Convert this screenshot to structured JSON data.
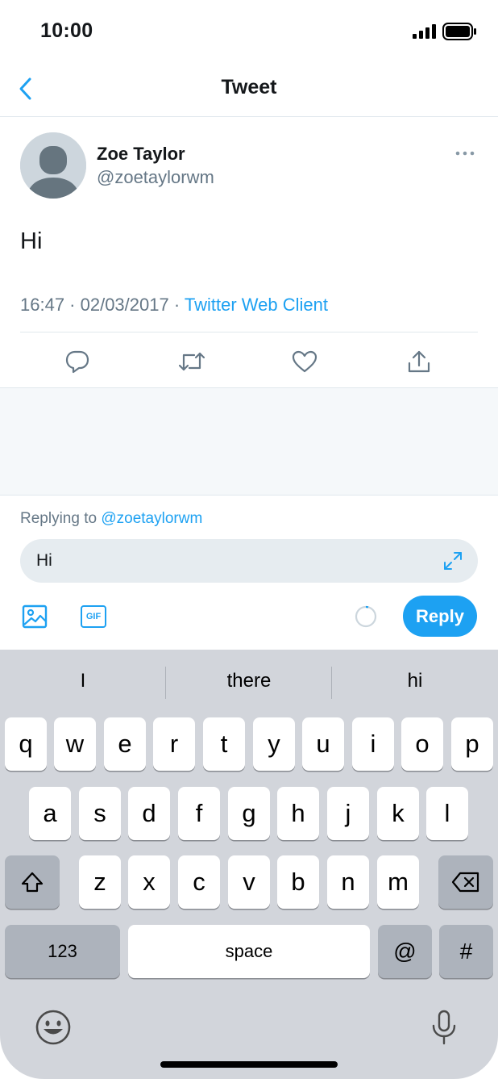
{
  "status_bar": {
    "time": "10:00"
  },
  "nav": {
    "title": "Tweet",
    "back_icon": "chevron-left-icon"
  },
  "tweet": {
    "author_name": "Zoe Taylor",
    "author_handle": "@zoetaylorwm",
    "text": "Hi",
    "timestamp": "16:47 · 02/03/2017 · ",
    "source": "Twitter Web Client",
    "actions": [
      "reply-icon",
      "retweet-icon",
      "like-icon",
      "share-icon"
    ]
  },
  "composer": {
    "replying_prefix": "Replying to ",
    "replying_handle": "@zoetaylorwm",
    "input_value": "Hi",
    "gif_label": "GIF",
    "reply_label": "Reply"
  },
  "keyboard": {
    "suggestions": [
      "I",
      "there",
      "hi"
    ],
    "row1": [
      "q",
      "w",
      "e",
      "r",
      "t",
      "y",
      "u",
      "i",
      "o",
      "p"
    ],
    "row2": [
      "a",
      "s",
      "d",
      "f",
      "g",
      "h",
      "j",
      "k",
      "l"
    ],
    "row3": [
      "z",
      "x",
      "c",
      "v",
      "b",
      "n",
      "m"
    ],
    "numbers_label": "123",
    "space_label": "space",
    "at_label": "@",
    "hash_label": "#"
  },
  "colors": {
    "accent": "#1da1f2",
    "secondary_text": "#657786",
    "keyboard_bg": "#d2d5db"
  }
}
